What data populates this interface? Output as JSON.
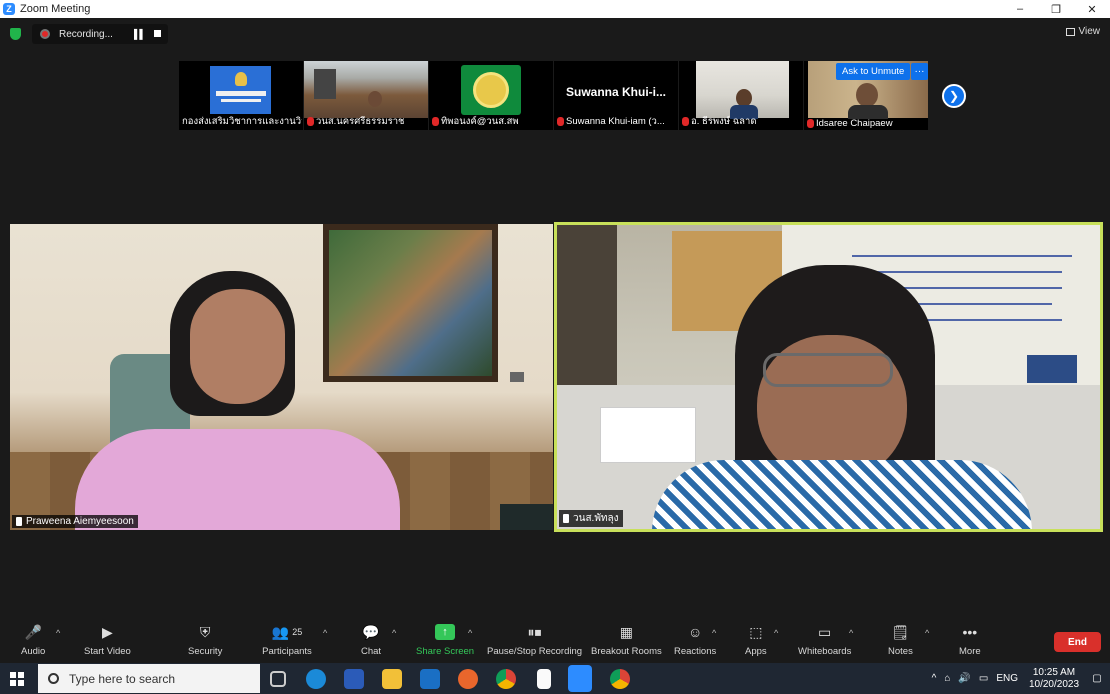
{
  "window": {
    "title": "Zoom Meeting",
    "controls": [
      "–",
      "❐",
      "✕"
    ]
  },
  "topbar": {
    "recording_label": "Recording...",
    "view_label": "View"
  },
  "thumbnails": [
    {
      "name": "กองส่งเสริมวิชาการและงานวิจัย",
      "muted": false
    },
    {
      "name": "วนส.นครศรีธรรมราช",
      "muted": true
    },
    {
      "name": "ทิพอนงค์@วนส.สพ",
      "muted": true
    },
    {
      "name": "Suwanna Khui-iam (ว...",
      "card_text": "Suwanna  Khui-i...",
      "muted": true
    },
    {
      "name": "อ. ธีรพงษ์ ฉลาด",
      "muted": true
    },
    {
      "name": "Idsaree Chaipaew",
      "muted": true
    }
  ],
  "ask_to_unmute": "Ask to Unmute",
  "more_dots": "···",
  "videos": {
    "left": {
      "name": "Praweena Aiemyeesoon"
    },
    "right": {
      "name": "วนส.พัทลุง"
    }
  },
  "toolbar": {
    "participant_count": "25",
    "items": [
      {
        "label": "Audio"
      },
      {
        "label": "Start Video"
      },
      {
        "label": "Security"
      },
      {
        "label": "Participants"
      },
      {
        "label": "Chat"
      },
      {
        "label": "Share Screen"
      },
      {
        "label": "Pause/Stop Recording"
      },
      {
        "label": "Breakout Rooms"
      },
      {
        "label": "Reactions"
      },
      {
        "label": "Apps"
      },
      {
        "label": "Whiteboards"
      },
      {
        "label": "Notes"
      },
      {
        "label": "More"
      }
    ],
    "end_label": "End",
    "colors": {
      "share": "#34c759",
      "end": "#d9302b",
      "accent": "#0e71eb"
    }
  },
  "taskbar": {
    "search_placeholder": "Type here to search",
    "lang": "ENG",
    "time": "10:25 AM",
    "date": "10/20/2023"
  }
}
